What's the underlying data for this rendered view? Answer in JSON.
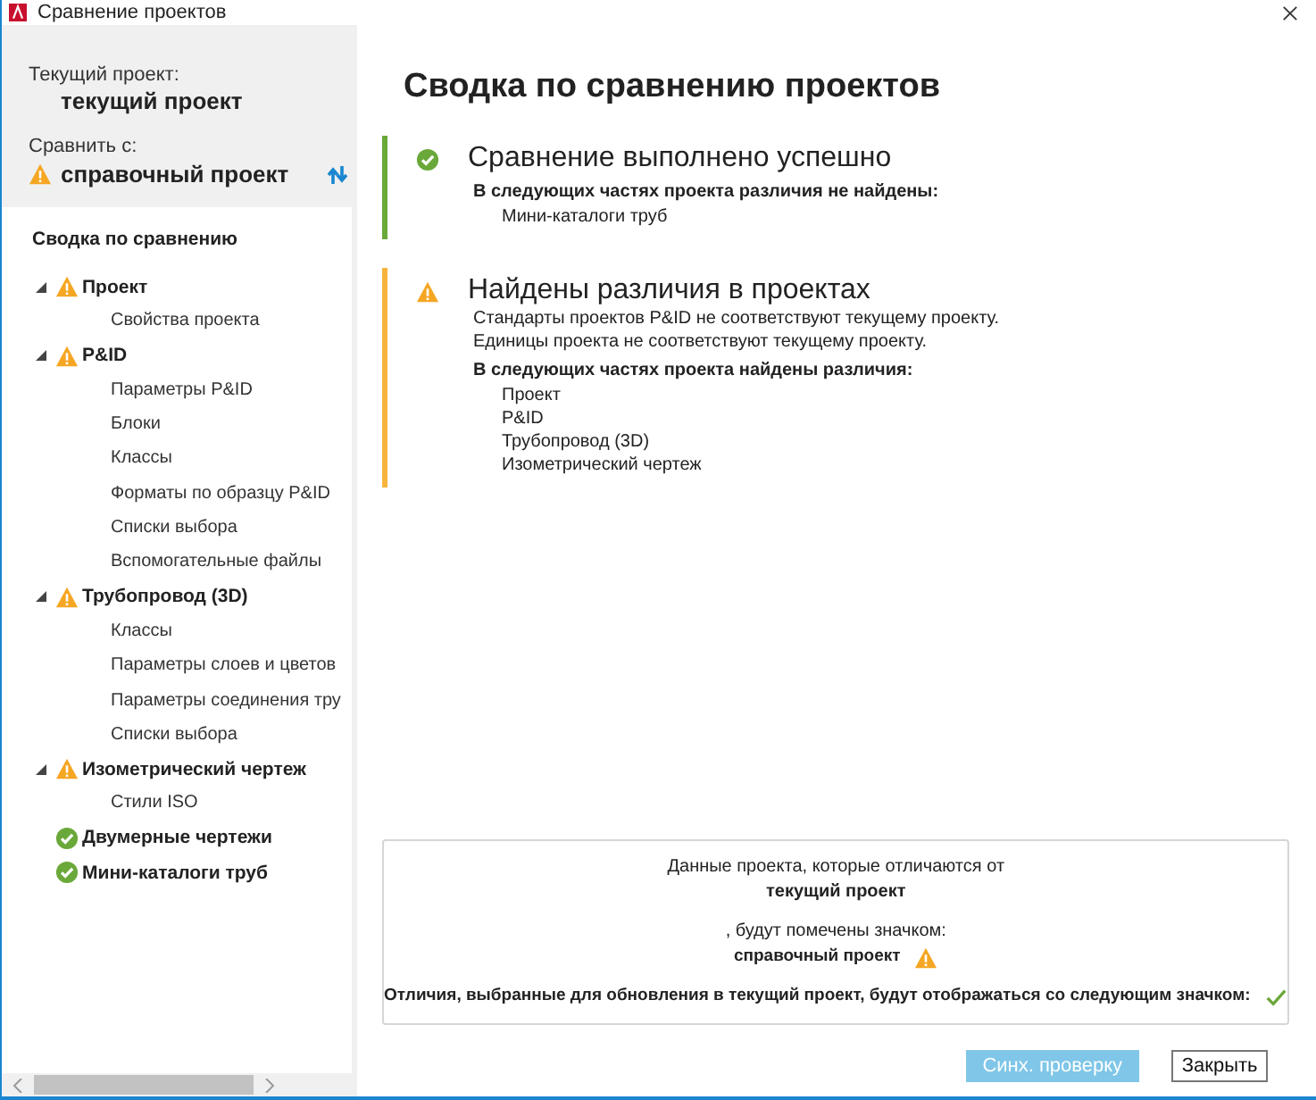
{
  "window": {
    "title": "Сравнение проектов"
  },
  "current_project": {
    "label": "Текущий проект:",
    "value": "текущий проект"
  },
  "compare_with": {
    "label": "Сравнить с:",
    "value": "справочный проект",
    "kind": "warning"
  },
  "tree": {
    "title": "Сводка по сравнению",
    "items": [
      {
        "label": "Проект",
        "kind": "warning",
        "expanded": true,
        "children": [
          {
            "label": "Свойства проекта"
          }
        ]
      },
      {
        "label": "P&ID",
        "kind": "warning",
        "expanded": true,
        "children": [
          {
            "label": "Параметры P&ID"
          },
          {
            "label": "Блоки"
          },
          {
            "label": "Классы"
          },
          {
            "label": "Форматы по образцу P&ID"
          },
          {
            "label": "Списки выбора"
          },
          {
            "label": "Вспомогательные файлы"
          }
        ]
      },
      {
        "label": "Трубопровод (3D)",
        "kind": "warning",
        "expanded": true,
        "children": [
          {
            "label": "Классы"
          },
          {
            "label": "Параметры слоев и цветов"
          },
          {
            "label": "Параметры соединения тру"
          },
          {
            "label": "Списки выбора"
          }
        ]
      },
      {
        "label": "Изометрический чертеж",
        "kind": "warning",
        "expanded": true,
        "children": [
          {
            "label": "Стили ISO"
          }
        ]
      },
      {
        "label": "Двумерные чертежи",
        "kind": "ok"
      },
      {
        "label": "Мини-каталоги труб",
        "kind": "ok"
      }
    ]
  },
  "summary": {
    "title": "Сводка по сравнению проектов",
    "sections": [
      {
        "kind": "ok",
        "heading": "Сравнение выполнено успешно",
        "list_title": "В следующих частях проекта различия не найдены:",
        "items": [
          "Мини-каталоги труб"
        ]
      },
      {
        "kind": "warning",
        "heading": "Найдены различия в проектах",
        "notes": [
          "Стандарты проектов P&ID не соответствуют текущему проекту.",
          "Единицы проекта не соответствуют текущему проекту."
        ],
        "list_title": "В следующих частях проекта найдены различия:",
        "items": [
          "Проект",
          "P&ID",
          "Трубопровод (3D)",
          "Изометрический чертеж"
        ]
      }
    ]
  },
  "legend": {
    "line_1": "Данные проекта, которые отличаются от",
    "current": "текущий проект",
    "line_2": ", будут помечены значком:",
    "reference": "справочный проект",
    "line_3": "Отличия, выбранные для обновления в текущий проект, будут отображаться со следующим значком:"
  },
  "buttons": [
    {
      "label": "Синх. проверку",
      "disabled": true
    },
    {
      "label": "Закрыть",
      "disabled": false
    }
  ]
}
